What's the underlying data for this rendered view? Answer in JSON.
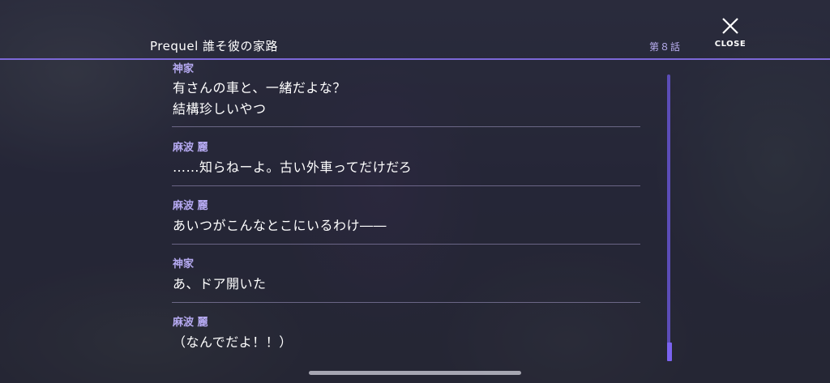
{
  "header": {
    "episode_title": "Prequel 誰そ彼の家路",
    "chapter": "第８話",
    "close_label": "CLOSE"
  },
  "log": {
    "entries": [
      {
        "speaker": "神家",
        "lines": [
          "有さんの車と、一緒だよな？",
          "結構珍しいやつ"
        ]
      },
      {
        "speaker": "麻波 麗",
        "lines": [
          "……知らねーよ。古い外車ってだけだろ"
        ]
      },
      {
        "speaker": "麻波 麗",
        "lines": [
          "あいつがこんなとこにいるわけ――"
        ]
      },
      {
        "speaker": "神家",
        "lines": [
          "あ、ドア開いた"
        ]
      },
      {
        "speaker": "麻波 麗",
        "lines": [
          "（なんでだよ！！）"
        ]
      }
    ]
  },
  "scroll": {
    "position_fraction": 1.0
  },
  "colors": {
    "accent": "#7c68d8",
    "speaker": "#b6aaf2",
    "text": "#ffffff"
  },
  "icons": {
    "close": "close-icon"
  }
}
